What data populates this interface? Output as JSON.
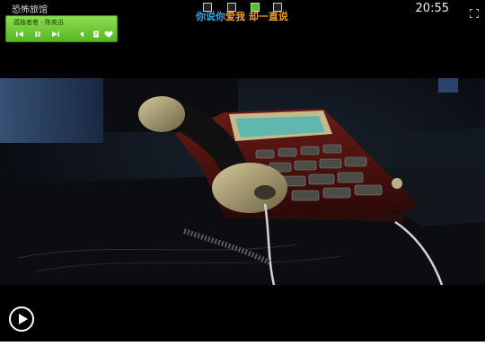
{
  "window": {
    "title": "恐怖旅馆",
    "clock": "20:55"
  },
  "lyric": {
    "sung": "你说你",
    "unsung": "爱我  却一直说"
  },
  "mini_player": {
    "song": "孤独者者 - 陈奕迅"
  },
  "icons": {
    "fullscreen": "fullscreen-icon",
    "previous": "previous-icon",
    "pause": "pause-icon",
    "next": "next-icon",
    "volume": "volume-icon",
    "playlist": "playlist-icon",
    "favorite": "heart-icon",
    "play": "play-icon"
  },
  "colors": {
    "player_green": "#6bc52f",
    "lyric_blue": "#2fa7e8",
    "lyric_orange": "#f0a11a"
  }
}
